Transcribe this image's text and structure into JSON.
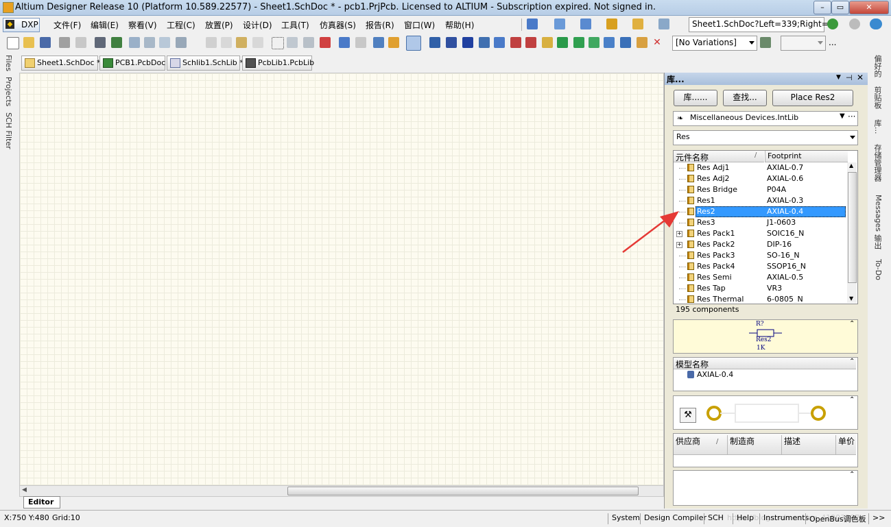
{
  "window": {
    "title": "Altium Designer Release 10 (Platform 10.589.22577) - Sheet1.SchDoc * - pcb1.PrjPcb. Licensed to ALTIUM - Subscription expired. Not signed in.",
    "minimize": "–",
    "maximize": "▭",
    "close": "✕"
  },
  "menu": {
    "dxp": "DXP",
    "items": [
      "文件(F)",
      "编辑(E)",
      "察看(V)",
      "工程(C)",
      "放置(P)",
      "设计(D)",
      "工具(T)",
      "仿真器(S)",
      "报告(R)",
      "窗口(W)",
      "帮助(H)"
    ],
    "nav_path": "Sheet1.SchDoc?Left=339;Right="
  },
  "toolbar": {
    "variations": "[No Variations]",
    "ellipsis": "..."
  },
  "doc_tabs": [
    "Sheet1.SchDoc *",
    "PCB1.PcbDoc",
    "Schlib1.SchLib *",
    "PcbLib1.PcbLib"
  ],
  "left_strip": [
    "Files",
    "Projects",
    "SCH Filter"
  ],
  "right_strip": [
    "偏好的",
    "剪贴板",
    "库...",
    "存储管理器",
    "Messages",
    "输出",
    "To-Do"
  ],
  "editor_tab": "Editor",
  "panel": {
    "title": "库...",
    "btn_lib": "库......",
    "btn_search": "查找...",
    "btn_place": "Place Res2",
    "library": "Miscellaneous Devices.IntLib",
    "filter": "Res",
    "col_name": "元件名称",
    "col_footprint": "Footprint",
    "components": [
      {
        "name": "Res Adj1",
        "footprint": "AXIAL-0.7",
        "expandable": false
      },
      {
        "name": "Res Adj2",
        "footprint": "AXIAL-0.6",
        "expandable": false
      },
      {
        "name": "Res Bridge",
        "footprint": "P04A",
        "expandable": false
      },
      {
        "name": "Res1",
        "footprint": "AXIAL-0.3",
        "expandable": false
      },
      {
        "name": "Res2",
        "footprint": "AXIAL-0.4",
        "expandable": false,
        "selected": true
      },
      {
        "name": "Res3",
        "footprint": "J1-0603",
        "expandable": false
      },
      {
        "name": "Res Pack1",
        "footprint": "SOIC16_N",
        "expandable": true
      },
      {
        "name": "Res Pack2",
        "footprint": "DIP-16",
        "expandable": true
      },
      {
        "name": "Res Pack3",
        "footprint": "SO-16_N",
        "expandable": false
      },
      {
        "name": "Res Pack4",
        "footprint": "SSOP16_N",
        "expandable": false
      },
      {
        "name": "Res Semi",
        "footprint": "AXIAL-0.5",
        "expandable": false
      },
      {
        "name": "Res Tap",
        "footprint": "VR3",
        "expandable": false
      },
      {
        "name": "Res Thermal",
        "footprint": "6-0805_N",
        "expandable": false
      }
    ],
    "count": "195 components",
    "preview": {
      "designator": "R?",
      "comment": "Res2",
      "value": "1K"
    },
    "model_header": "模型名称",
    "model_name": "AXIAL-0.4",
    "supplier_cols": [
      "供应商",
      "制造商",
      "描述",
      "单价"
    ]
  },
  "status": {
    "coords": "X:750 Y:480",
    "grid": "Grid:10",
    "tabs": [
      "System",
      "Design Compiler",
      "SCH",
      "Help",
      "Instruments",
      "OpenBus调色板"
    ],
    "more": ">>",
    "watermark": "https://blog.csdn.net/qq_41903307"
  },
  "colors": {
    "selection": "#3399ff",
    "arrow": "#e53935",
    "canvas": "#fdfbf0",
    "preview_bg": "#fffbd8",
    "pad": "#c8a000"
  }
}
